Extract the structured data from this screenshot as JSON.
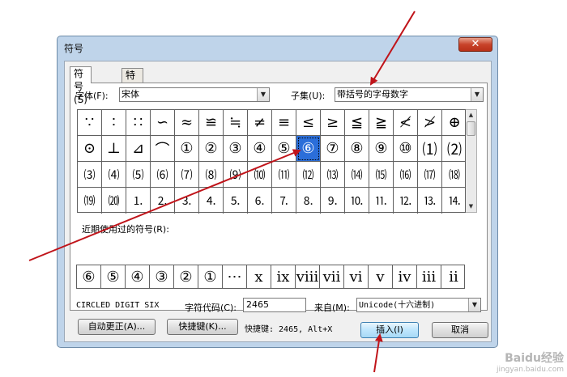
{
  "dialog": {
    "title": "符号",
    "close_label": "✕",
    "tabs": [
      {
        "label": "符号(S)",
        "active": true
      },
      {
        "label": "特殊字符(P)",
        "active": false
      }
    ],
    "font": {
      "label": "字体(F):",
      "value": "宋体"
    },
    "subset": {
      "label": "子集(U):",
      "value": "带括号的字母数字"
    },
    "symbol_rows": [
      [
        "∵",
        "∶",
        "∷",
        "∽",
        "≈",
        "≌",
        "≒",
        "≠",
        "≡",
        "≤",
        "≥",
        "≦",
        "≧",
        "≮",
        "≯",
        "⊕"
      ],
      [
        "⊙",
        "⊥",
        "⊿",
        "⌒",
        "①",
        "②",
        "③",
        "④",
        "⑤",
        "⑥",
        "⑦",
        "⑧",
        "⑨",
        "⑩",
        "⑴",
        "⑵"
      ],
      [
        "⑶",
        "⑷",
        "⑸",
        "⑹",
        "⑺",
        "⑻",
        "⑼",
        "⑽",
        "⑾",
        "⑿",
        "⒀",
        "⒁",
        "⒂",
        "⒃",
        "⒄",
        "⒅"
      ],
      [
        "⒆",
        "⒇",
        "⒈",
        "⒉",
        "⒊",
        "⒋",
        "⒌",
        "⒍",
        "⒎",
        "⒏",
        "⒐",
        "⒑",
        "⒒",
        "⒓",
        "⒔",
        "⒕"
      ]
    ],
    "selected_symbol": "⑥",
    "recent_label": "近期使用过的符号(R):",
    "recent_symbols": [
      "⑥",
      "⑤",
      "④",
      "③",
      "②",
      "①",
      "⋯",
      "ⅹ",
      "ⅸ",
      "ⅷ",
      "ⅶ",
      "ⅵ",
      "ⅴ",
      "ⅳ",
      "ⅲ",
      "ⅱ"
    ],
    "char_name": "CIRCLED DIGIT SIX",
    "char_code_label": "字符代码(C):",
    "char_code_value": "2465",
    "from_label": "来自(M):",
    "from_value": "Unicode(十六进制)",
    "autocorrect_button": "自动更正(A)...",
    "shortcut_key_button": "快捷键(K)...",
    "shortcut_text": "快捷键: 2465, Alt+X",
    "insert_button": "插入(I)",
    "cancel_button": "取消"
  },
  "watermark": {
    "line1": "Baidu经验",
    "line2": "jingyan.baidu.com"
  },
  "colors": {
    "selection": "#2b6ed9",
    "annotation_arrow": "#c0141a",
    "window_frame": "#bfd4ea"
  }
}
